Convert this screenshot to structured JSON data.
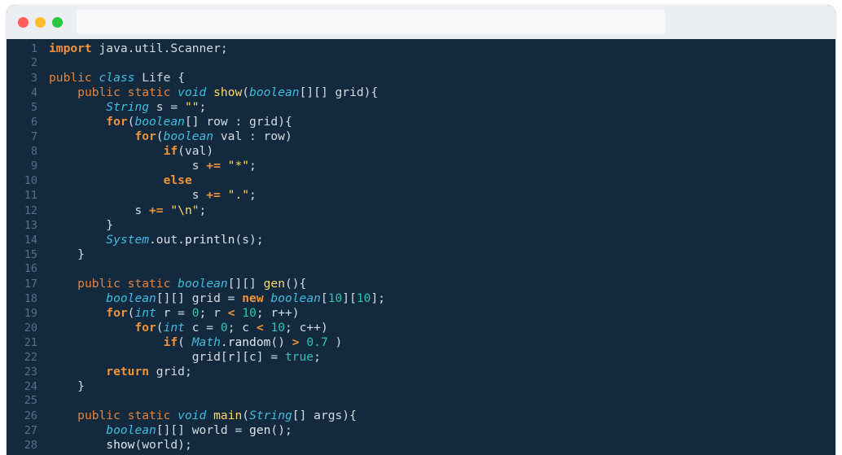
{
  "window": {
    "traffic_lights": [
      {
        "name": "close-button",
        "color": "#ff5f56"
      },
      {
        "name": "minimize-button",
        "color": "#ffbd2e"
      },
      {
        "name": "maximize-button",
        "color": "#27c93f"
      }
    ],
    "addressbar": {
      "value": "",
      "placeholder": ""
    }
  },
  "editor": {
    "language": "java",
    "background": "#13293d",
    "line_number_color": "#54728a",
    "first_visible_line": 1,
    "last_visible_line": 28,
    "colors": {
      "keyword": "#f29338",
      "type": "#41bde0",
      "string": "#ffd866",
      "method": "#ffd866",
      "number": "#2ec4b6",
      "operator": "#f29338",
      "plain": "#d5dde3"
    },
    "lines": [
      {
        "n": "1",
        "tokens": [
          {
            "t": "import",
            "c": "kw"
          },
          {
            "t": " java.util.Scanner;",
            "c": "pl"
          }
        ]
      },
      {
        "n": "2",
        "tokens": []
      },
      {
        "n": "3",
        "tokens": [
          {
            "t": "public ",
            "c": "kws"
          },
          {
            "t": "class",
            "c": "typ"
          },
          {
            "t": " ",
            "c": "pl"
          },
          {
            "t": "Life",
            "c": "cls"
          },
          {
            "t": " {",
            "c": "pl"
          }
        ]
      },
      {
        "n": "4",
        "tokens": [
          {
            "t": "    ",
            "c": "pl"
          },
          {
            "t": "public static ",
            "c": "kws"
          },
          {
            "t": "void",
            "c": "typ"
          },
          {
            "t": " ",
            "c": "pl"
          },
          {
            "t": "show",
            "c": "fn"
          },
          {
            "t": "(",
            "c": "pl"
          },
          {
            "t": "boolean",
            "c": "typ"
          },
          {
            "t": "[][] grid){",
            "c": "pl"
          }
        ]
      },
      {
        "n": "5",
        "tokens": [
          {
            "t": "        ",
            "c": "pl"
          },
          {
            "t": "String",
            "c": "typ"
          },
          {
            "t": " s = ",
            "c": "pl"
          },
          {
            "t": "\"\"",
            "c": "str"
          },
          {
            "t": ";",
            "c": "pl"
          }
        ]
      },
      {
        "n": "6",
        "tokens": [
          {
            "t": "        ",
            "c": "pl"
          },
          {
            "t": "for",
            "c": "kw"
          },
          {
            "t": "(",
            "c": "pl"
          },
          {
            "t": "boolean",
            "c": "typ"
          },
          {
            "t": "[] row : grid){",
            "c": "pl"
          }
        ]
      },
      {
        "n": "7",
        "tokens": [
          {
            "t": "            ",
            "c": "pl"
          },
          {
            "t": "for",
            "c": "kw"
          },
          {
            "t": "(",
            "c": "pl"
          },
          {
            "t": "boolean",
            "c": "typ"
          },
          {
            "t": " val : row)",
            "c": "pl"
          }
        ]
      },
      {
        "n": "8",
        "tokens": [
          {
            "t": "                ",
            "c": "pl"
          },
          {
            "t": "if",
            "c": "kw"
          },
          {
            "t": "(val)",
            "c": "pl"
          }
        ]
      },
      {
        "n": "9",
        "tokens": [
          {
            "t": "                    s ",
            "c": "pl"
          },
          {
            "t": "+=",
            "c": "op"
          },
          {
            "t": " ",
            "c": "pl"
          },
          {
            "t": "\"*\"",
            "c": "str"
          },
          {
            "t": ";",
            "c": "pl"
          }
        ]
      },
      {
        "n": "10",
        "tokens": [
          {
            "t": "                ",
            "c": "pl"
          },
          {
            "t": "else",
            "c": "kw"
          }
        ]
      },
      {
        "n": "11",
        "tokens": [
          {
            "t": "                    s ",
            "c": "pl"
          },
          {
            "t": "+=",
            "c": "op"
          },
          {
            "t": " ",
            "c": "pl"
          },
          {
            "t": "\".\"",
            "c": "str"
          },
          {
            "t": ";",
            "c": "pl"
          }
        ]
      },
      {
        "n": "12",
        "tokens": [
          {
            "t": "            s ",
            "c": "pl"
          },
          {
            "t": "+=",
            "c": "op"
          },
          {
            "t": " ",
            "c": "pl"
          },
          {
            "t": "\"\\n\"",
            "c": "str"
          },
          {
            "t": ";",
            "c": "pl"
          }
        ]
      },
      {
        "n": "13",
        "tokens": [
          {
            "t": "        }",
            "c": "pl"
          }
        ]
      },
      {
        "n": "14",
        "tokens": [
          {
            "t": "        ",
            "c": "pl"
          },
          {
            "t": "System",
            "c": "typ"
          },
          {
            "t": ".out.",
            "c": "pl"
          },
          {
            "t": "println",
            "c": "mth"
          },
          {
            "t": "(s);",
            "c": "pl"
          }
        ]
      },
      {
        "n": "15",
        "tokens": [
          {
            "t": "    }",
            "c": "pl"
          }
        ]
      },
      {
        "n": "16",
        "tokens": []
      },
      {
        "n": "17",
        "tokens": [
          {
            "t": "    ",
            "c": "pl"
          },
          {
            "t": "public static ",
            "c": "kws"
          },
          {
            "t": "boolean",
            "c": "typ"
          },
          {
            "t": "[][] ",
            "c": "pl"
          },
          {
            "t": "gen",
            "c": "fn"
          },
          {
            "t": "(){",
            "c": "pl"
          }
        ]
      },
      {
        "n": "18",
        "tokens": [
          {
            "t": "        ",
            "c": "pl"
          },
          {
            "t": "boolean",
            "c": "typ"
          },
          {
            "t": "[][] grid = ",
            "c": "pl"
          },
          {
            "t": "new",
            "c": "kw"
          },
          {
            "t": " ",
            "c": "pl"
          },
          {
            "t": "boolean",
            "c": "typ"
          },
          {
            "t": "[",
            "c": "pl"
          },
          {
            "t": "10",
            "c": "num"
          },
          {
            "t": "][",
            "c": "pl"
          },
          {
            "t": "10",
            "c": "num"
          },
          {
            "t": "];",
            "c": "pl"
          }
        ]
      },
      {
        "n": "19",
        "tokens": [
          {
            "t": "        ",
            "c": "pl"
          },
          {
            "t": "for",
            "c": "kw"
          },
          {
            "t": "(",
            "c": "pl"
          },
          {
            "t": "int",
            "c": "typ"
          },
          {
            "t": " r = ",
            "c": "pl"
          },
          {
            "t": "0",
            "c": "num"
          },
          {
            "t": "; r ",
            "c": "pl"
          },
          {
            "t": "<",
            "c": "op"
          },
          {
            "t": " ",
            "c": "pl"
          },
          {
            "t": "10",
            "c": "num"
          },
          {
            "t": "; r++)",
            "c": "pl"
          }
        ]
      },
      {
        "n": "20",
        "tokens": [
          {
            "t": "            ",
            "c": "pl"
          },
          {
            "t": "for",
            "c": "kw"
          },
          {
            "t": "(",
            "c": "pl"
          },
          {
            "t": "int",
            "c": "typ"
          },
          {
            "t": " c = ",
            "c": "pl"
          },
          {
            "t": "0",
            "c": "num"
          },
          {
            "t": "; c ",
            "c": "pl"
          },
          {
            "t": "<",
            "c": "op"
          },
          {
            "t": " ",
            "c": "pl"
          },
          {
            "t": "10",
            "c": "num"
          },
          {
            "t": "; c++)",
            "c": "pl"
          }
        ]
      },
      {
        "n": "21",
        "tokens": [
          {
            "t": "                ",
            "c": "pl"
          },
          {
            "t": "if",
            "c": "kw"
          },
          {
            "t": "( ",
            "c": "pl"
          },
          {
            "t": "Math",
            "c": "typ"
          },
          {
            "t": ".",
            "c": "pl"
          },
          {
            "t": "random",
            "c": "mth"
          },
          {
            "t": "() ",
            "c": "pl"
          },
          {
            "t": ">",
            "c": "op"
          },
          {
            "t": " ",
            "c": "pl"
          },
          {
            "t": "0.7",
            "c": "num"
          },
          {
            "t": " )",
            "c": "pl"
          }
        ]
      },
      {
        "n": "22",
        "tokens": [
          {
            "t": "                    grid[r][c] = ",
            "c": "pl"
          },
          {
            "t": "true",
            "c": "num"
          },
          {
            "t": ";",
            "c": "pl"
          }
        ]
      },
      {
        "n": "23",
        "tokens": [
          {
            "t": "        ",
            "c": "pl"
          },
          {
            "t": "return",
            "c": "kw"
          },
          {
            "t": " grid;",
            "c": "pl"
          }
        ]
      },
      {
        "n": "24",
        "tokens": [
          {
            "t": "    }",
            "c": "pl"
          }
        ]
      },
      {
        "n": "25",
        "tokens": []
      },
      {
        "n": "26",
        "tokens": [
          {
            "t": "    ",
            "c": "pl"
          },
          {
            "t": "public static ",
            "c": "kws"
          },
          {
            "t": "void",
            "c": "typ"
          },
          {
            "t": " ",
            "c": "pl"
          },
          {
            "t": "main",
            "c": "fn"
          },
          {
            "t": "(",
            "c": "pl"
          },
          {
            "t": "String",
            "c": "typ"
          },
          {
            "t": "[] args){",
            "c": "pl"
          }
        ]
      },
      {
        "n": "27",
        "tokens": [
          {
            "t": "        ",
            "c": "pl"
          },
          {
            "t": "boolean",
            "c": "typ"
          },
          {
            "t": "[][] world = ",
            "c": "pl"
          },
          {
            "t": "gen",
            "c": "mth"
          },
          {
            "t": "();",
            "c": "pl"
          }
        ]
      },
      {
        "n": "28",
        "tokens": [
          {
            "t": "        ",
            "c": "pl"
          },
          {
            "t": "show",
            "c": "mth"
          },
          {
            "t": "(world);",
            "c": "pl"
          }
        ]
      }
    ]
  }
}
